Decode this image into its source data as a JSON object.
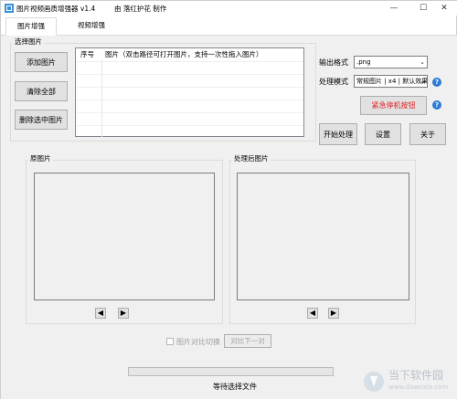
{
  "window": {
    "title": "图片视频画质增强器 v1.4",
    "author": "由 落红护花 制作",
    "minimize_icon": "minimize-icon",
    "maximize_icon": "maximize-icon",
    "close_icon": "close-icon"
  },
  "tabs": [
    {
      "label": "图片增强",
      "active": true
    },
    {
      "label": "视频增强",
      "active": false
    }
  ],
  "select_group": {
    "label": "选择图片",
    "buttons": {
      "add": "添加图片",
      "clear": "清除全部",
      "delete": "删除选中图片"
    },
    "list": {
      "col_index": "序号",
      "col_image": "图片（双击路径可打开图片，支持一次性拖入图片）"
    }
  },
  "settings": {
    "output_format_label": "输出格式",
    "output_format_value": ".png",
    "mode_label": "处理模式",
    "mode_value": "常规图片 | x4 | 默认效果",
    "emergency_stop": "紧急停机按钮",
    "start": "开始处理",
    "settings": "设置",
    "about": "关于"
  },
  "preview": {
    "original_label": "原图片",
    "processed_label": "处理后图片",
    "prev_symbol": "◀",
    "next_symbol": "▶"
  },
  "compare": {
    "toggle_label": "图片对比切换",
    "next_pair": "对比下一对"
  },
  "status": {
    "progress": 0,
    "text": "等待选择文件"
  },
  "watermark": {
    "text": "当下软件园",
    "subtext": "www.downxia.com"
  },
  "colors": {
    "accent": "#2d7bd4",
    "danger_text": "#e02020",
    "panel_bg": "#f0f0f0"
  }
}
